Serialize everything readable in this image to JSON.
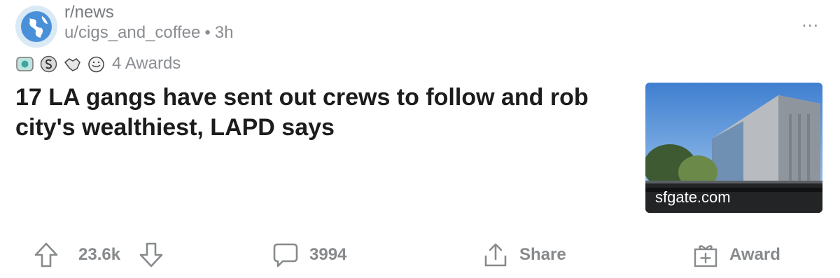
{
  "post": {
    "subreddit": "r/news",
    "author": "u/cigs_and_coffee",
    "separator": "•",
    "age": "3h",
    "more_label": "...",
    "awards_label": "4 Awards",
    "award_icons": [
      "helpful-award-icon",
      "silver-award-icon",
      "handshake-award-icon",
      "wholesome-award-icon"
    ],
    "title": "17 LA gangs have sent out crews to follow and rob city's wealthiest, LAPD says",
    "thumbnail_domain": "sfgate.com"
  },
  "actions": {
    "upvotes": "23.6k",
    "comments": "3994",
    "share_label": "Share",
    "award_label": "Award"
  },
  "colors": {
    "text_primary": "#1c1c1c",
    "text_muted": "#878a8c",
    "avatar_bg": "#d9e9f5",
    "avatar_globe": "#4a90d9"
  }
}
